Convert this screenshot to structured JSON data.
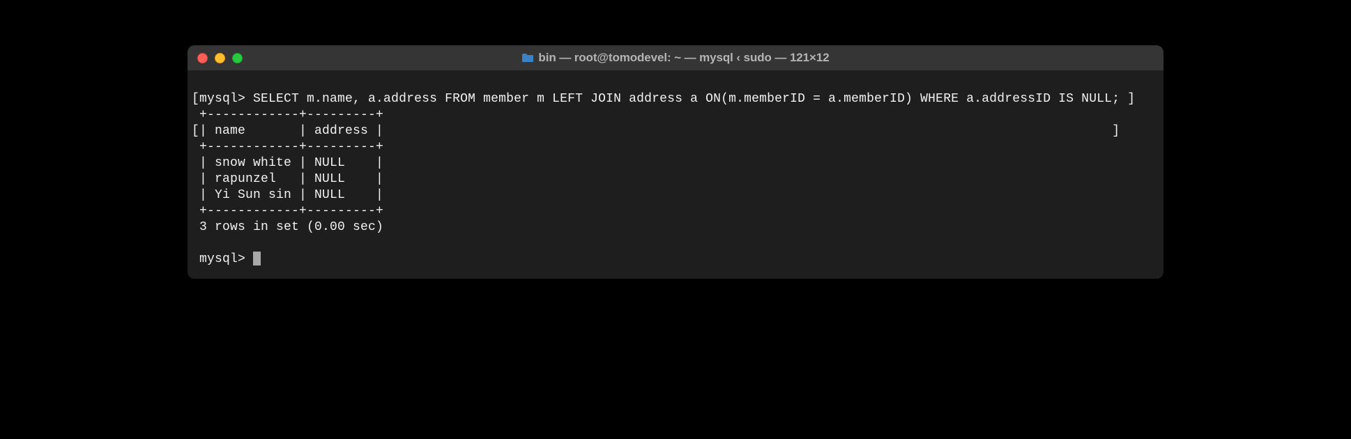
{
  "window": {
    "title": "bin — root@tomodevel: ~ — mysql ‹ sudo — 121×12"
  },
  "terminal": {
    "line1_prefix": "[",
    "prompt1": "mysql> ",
    "query": "SELECT m.name, a.address FROM member m LEFT JOIN address a ON(m.memberID = a.memberID) WHERE a.addressID IS NULL; ",
    "line1_suffix": "]",
    "sep_top": " +------------+---------+",
    "header_prefix": "[",
    "header": "| name       | address |",
    "header_suffix": "]",
    "sep_mid": " +------------+---------+",
    "row1": " | snow white | NULL    |",
    "row2": " | rapunzel   | NULL    |",
    "row3": " | Yi Sun sin | NULL    |",
    "sep_bot": " +------------+---------+",
    "result": " 3 rows in set (0.00 sec)",
    "blank": "",
    "prompt2": " mysql> "
  }
}
